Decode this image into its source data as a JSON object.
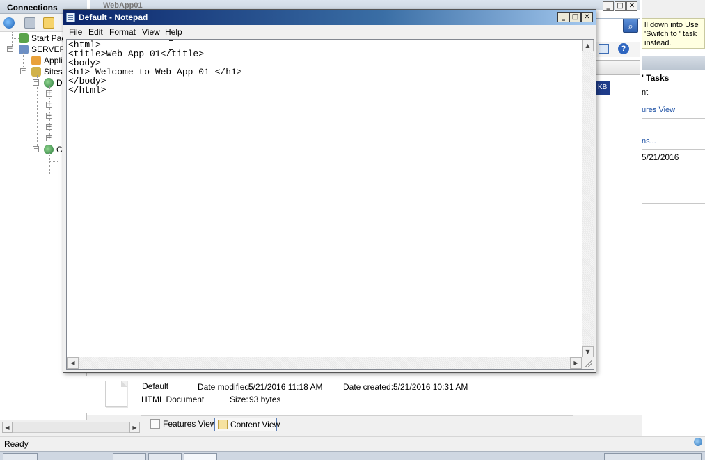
{
  "iis": {
    "connections_label": "Connections",
    "address_text": "WebApp01",
    "tree": [
      {
        "label": "Start Pag",
        "icon": "start-page-icon"
      },
      {
        "label": "SERVER2",
        "icon": "server-icon"
      },
      {
        "label": "Appli",
        "icon": "app-pools-icon"
      },
      {
        "label": "Sites",
        "icon": "sites-icon"
      },
      {
        "label": "D",
        "icon": "globe-icon"
      },
      {
        "label": "C",
        "icon": "globe-icon"
      }
    ],
    "tip_text": "ll down into Use 'Switch to ' task instead.",
    "tasks_title": "' Tasks",
    "task_links": [
      "nt",
      "ures View",
      "ns...",
      "5/21/2016"
    ],
    "kb_badge": "KB",
    "file_details": {
      "name": "Default",
      "type": "HTML Document",
      "date_modified_label": "Date modified:",
      "date_modified": "5/21/2016 11:18 AM",
      "date_created_label": "Date created:",
      "date_created": "5/21/2016 10:31 AM",
      "size_label": "Size:",
      "size": "93 bytes"
    },
    "view_tabs": {
      "features": "Features View",
      "content": "Content View"
    },
    "status": "Ready",
    "colors": {
      "accent": "#1f52a5",
      "tip_bg": "#ffffe1"
    }
  },
  "notepad": {
    "title": "Default - Notepad",
    "menu": [
      "File",
      "Edit",
      "Format",
      "View",
      "Help"
    ],
    "content": "<html>\n<title>Web App 01</title>\n<body>\n<h1> Welcome to Web App 01 </h1>\n</body>\n</html>",
    "caption_buttons": {
      "minimize": "_",
      "maximize": "□",
      "close": "✕"
    }
  }
}
